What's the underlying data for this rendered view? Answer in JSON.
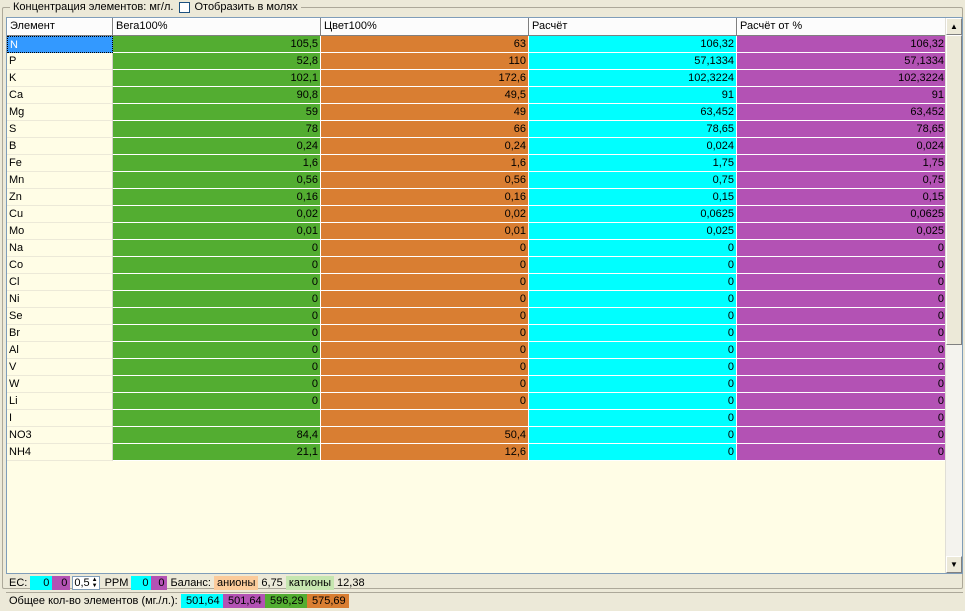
{
  "group": {
    "title": "Концентрация элементов: мг/л.",
    "checkbox_label": "Отобразить в молях"
  },
  "grid": {
    "columns": [
      "Элемент",
      "Вега100%",
      "Цвет100%",
      "Расчёт",
      "Расчёт от %"
    ],
    "rows": [
      [
        "N",
        "105,5",
        "63",
        "106,32",
        "106,32"
      ],
      [
        "P",
        "52,8",
        "110",
        "57,1334",
        "57,1334"
      ],
      [
        "K",
        "102,1",
        "172,6",
        "102,3224",
        "102,3224"
      ],
      [
        "Ca",
        "90,8",
        "49,5",
        "91",
        "91"
      ],
      [
        "Mg",
        "59",
        "49",
        "63,452",
        "63,452"
      ],
      [
        "S",
        "78",
        "66",
        "78,65",
        "78,65"
      ],
      [
        "B",
        "0,24",
        "0,24",
        "0,024",
        "0,024"
      ],
      [
        "Fe",
        "1,6",
        "1,6",
        "1,75",
        "1,75"
      ],
      [
        "Mn",
        "0,56",
        "0,56",
        "0,75",
        "0,75"
      ],
      [
        "Zn",
        "0,16",
        "0,16",
        "0,15",
        "0,15"
      ],
      [
        "Cu",
        "0,02",
        "0,02",
        "0,0625",
        "0,0625"
      ],
      [
        "Mo",
        "0,01",
        "0,01",
        "0,025",
        "0,025"
      ],
      [
        "Na",
        "0",
        "0",
        "0",
        "0"
      ],
      [
        "Co",
        "0",
        "0",
        "0",
        "0"
      ],
      [
        "Cl",
        "0",
        "0",
        "0",
        "0"
      ],
      [
        "Ni",
        "0",
        "0",
        "0",
        "0"
      ],
      [
        "Se",
        "0",
        "0",
        "0",
        "0"
      ],
      [
        "Br",
        "0",
        "0",
        "0",
        "0"
      ],
      [
        "Al",
        "0",
        "0",
        "0",
        "0"
      ],
      [
        "V",
        "0",
        "0",
        "0",
        "0"
      ],
      [
        "W",
        "0",
        "0",
        "0",
        "0"
      ],
      [
        "Li",
        "0",
        "0",
        "0",
        "0"
      ],
      [
        "I",
        "",
        "",
        "0",
        "0"
      ],
      [
        "NO3",
        "84,4",
        "50,4",
        "0",
        "0"
      ],
      [
        "NH4",
        "21,1",
        "12,6",
        "0",
        "0"
      ]
    ],
    "selected_row": 0
  },
  "status": {
    "ec_label": "EC:",
    "ec_cyan": "0",
    "ec_purple": "0",
    "spin_value": "0,5",
    "ppm_label": "PPM",
    "ppm_cyan": "0",
    "ppm_purple": "0",
    "balance_label": "Баланс:",
    "anions_label": "анионы",
    "anions_value": "6,75",
    "cations_label": "катионы",
    "cations_value": "12,38"
  },
  "totals": {
    "label": "Общее кол-во элементов (мг./л.):",
    "cyan": "501,64",
    "purple": "501,64",
    "green": "596,29",
    "orange": "575,69"
  },
  "colors": {
    "vega": "#53ad31",
    "cvet": "#d97e32",
    "raschet": "#00ffff",
    "raschet_pct": "#b352b4"
  },
  "icons": {
    "scroll_up": "up-arrow-icon",
    "scroll_down": "down-arrow-icon",
    "spin": "spin-arrows-icon"
  }
}
